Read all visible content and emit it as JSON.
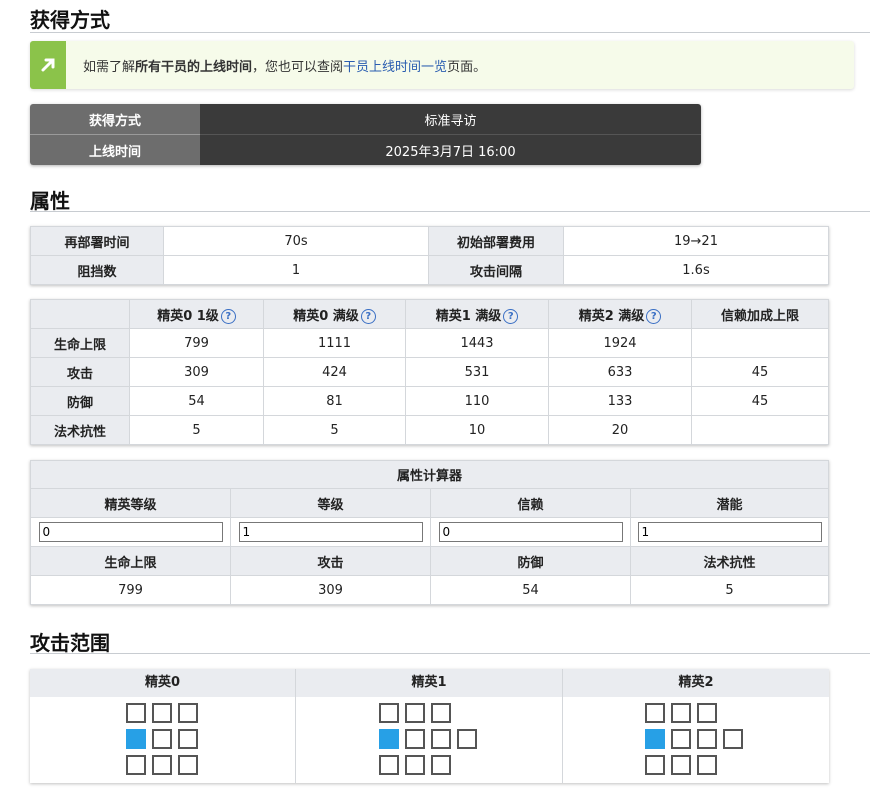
{
  "sections": {
    "obtain": "获得方式",
    "attributes": "属性",
    "range": "攻击范围"
  },
  "notice": {
    "prefix": "如需了解",
    "bold": "所有干员的上线时间",
    "middle": "，您也可以查阅",
    "link": "干员上线时间一览",
    "suffix": "页面。"
  },
  "obtain_table": [
    {
      "label": "获得方式",
      "value": "标准寻访"
    },
    {
      "label": "上线时间",
      "value": "2025年3月7日 16:00"
    }
  ],
  "basic_table": {
    "redeploy_label": "再部署时间",
    "redeploy_value": "70s",
    "cost_label": "初始部署费用",
    "cost_value": "19→21",
    "block_label": "阻挡数",
    "block_value": "1",
    "interval_label": "攻击间隔",
    "interval_value": "1.6s"
  },
  "stats_table": {
    "headers": [
      "精英0 1级",
      "精英0 满级",
      "精英1 满级",
      "精英2 满级",
      "信赖加成上限"
    ],
    "rows": [
      {
        "label": "生命上限",
        "values": [
          "799",
          "1111",
          "1443",
          "1924",
          ""
        ]
      },
      {
        "label": "攻击",
        "values": [
          "309",
          "424",
          "531",
          "633",
          "45"
        ]
      },
      {
        "label": "防御",
        "values": [
          "54",
          "81",
          "110",
          "133",
          "45"
        ]
      },
      {
        "label": "法术抗性",
        "values": [
          "5",
          "5",
          "10",
          "20",
          ""
        ]
      }
    ],
    "help_glyph": "?"
  },
  "calculator": {
    "title": "属性计算器",
    "input_labels": [
      "精英等级",
      "等级",
      "信赖",
      "潜能"
    ],
    "input_values": [
      "0",
      "1",
      "0",
      "1"
    ],
    "result_labels": [
      "生命上限",
      "攻击",
      "防御",
      "法术抗性"
    ],
    "result_values": [
      "799",
      "309",
      "54",
      "5"
    ]
  },
  "range_table": {
    "headers": [
      "精英0",
      "精英1",
      "精英2"
    ]
  },
  "colors": {
    "notice_accent": "#8bc34a",
    "self_cell": "#27a0e6",
    "link": "#2a5db0"
  }
}
